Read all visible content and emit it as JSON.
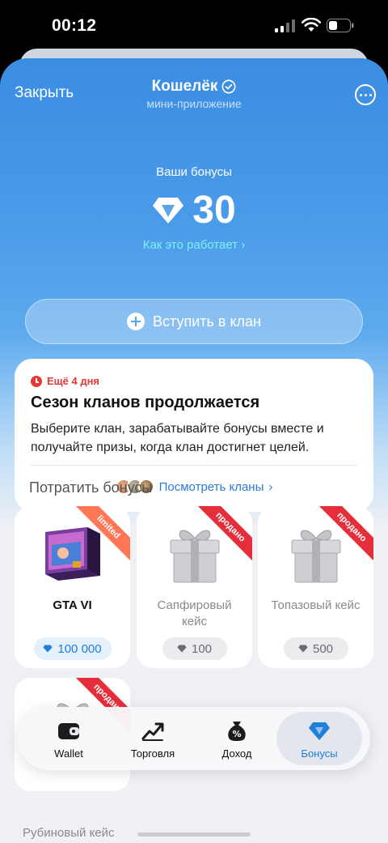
{
  "status_bar": {
    "time": "00:12"
  },
  "header": {
    "close_label": "Закрыть",
    "title": "Кошелёк",
    "subtitle": "мини-приложение"
  },
  "bonuses": {
    "label": "Ваши бонусы",
    "amount": "30",
    "how_link": "Как это работает"
  },
  "join_button": "Вступить в клан",
  "clan_card": {
    "badge": "Ещё 4 дня",
    "title": "Сезон кланов продолжается",
    "description": "Выберите клан, зарабатывайте бонусы вместе и получайте призы, когда клан достигнет целей.",
    "link": "Посмотреть кланы"
  },
  "spend_section": {
    "title": "Потратить бонусы",
    "items": [
      {
        "name": "GTA VI",
        "price": "100 000",
        "ribbon": "limited",
        "status": "available"
      },
      {
        "name": "Сапфировый кейс",
        "price": "100",
        "ribbon": "продано",
        "status": "sold"
      },
      {
        "name": "Топазовый кейс",
        "price": "500",
        "ribbon": "продано",
        "status": "sold"
      },
      {
        "name": "Рубиновый кейс",
        "price": "",
        "ribbon": "продано",
        "status": "sold"
      }
    ]
  },
  "tabbar": {
    "tabs": [
      {
        "label": "Wallet",
        "icon": "wallet-icon"
      },
      {
        "label": "Торговля",
        "icon": "trade-chart-icon"
      },
      {
        "label": "Доход",
        "icon": "percent-bag-icon"
      },
      {
        "label": "Бонусы",
        "icon": "diamond-icon",
        "active": true
      }
    ]
  },
  "colors": {
    "accent": "#1f7fd9",
    "header_gradient_top": "#3a8de3",
    "sold_ribbon": "#e52e3a",
    "limited_ribbon": "#ff7757",
    "urgent": "#e53935"
  }
}
